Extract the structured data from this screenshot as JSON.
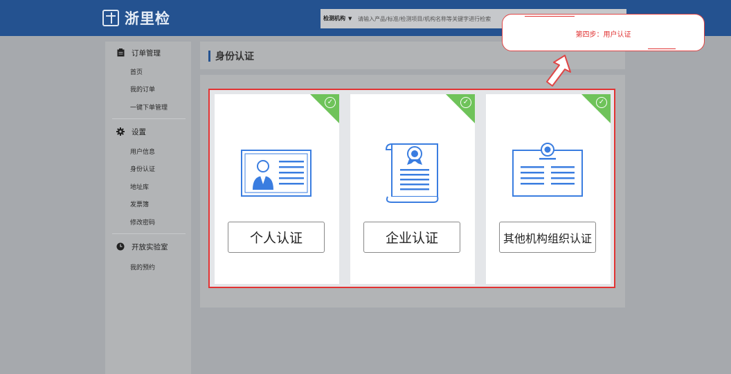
{
  "header": {
    "logo_text": "浙里检",
    "search": {
      "category": "检测机构",
      "placeholder": "请输入产品/标准/检测项目/机构名称等关键字进行检索"
    }
  },
  "sidebar": {
    "sections": [
      {
        "title": "订单管理",
        "icon": "clipboard-icon",
        "items": [
          "首页",
          "我的订单",
          "一键下单管理"
        ]
      },
      {
        "title": "设置",
        "icon": "gear-icon",
        "items": [
          "用户信息",
          "身份认证",
          "地址库",
          "发票簿",
          "修改密码"
        ]
      },
      {
        "title": "开放实验室",
        "icon": "clock-icon",
        "items": [
          "我的预约"
        ]
      }
    ]
  },
  "main": {
    "title": "身份认证",
    "cards": [
      {
        "label": "个人认证",
        "icon": "person-id-card-icon",
        "status": "checked"
      },
      {
        "label": "企业认证",
        "icon": "certificate-scroll-icon",
        "status": "checked"
      },
      {
        "label": "其他机构组织认证",
        "icon": "organization-certificate-icon",
        "status": "checked"
      }
    ]
  },
  "callout": {
    "text": "第四步：用户认证"
  },
  "colors": {
    "header_bg": "#245290",
    "accent_blue": "#3a7de0",
    "check_green": "#6fc35a",
    "highlight_red": "#e23232"
  }
}
